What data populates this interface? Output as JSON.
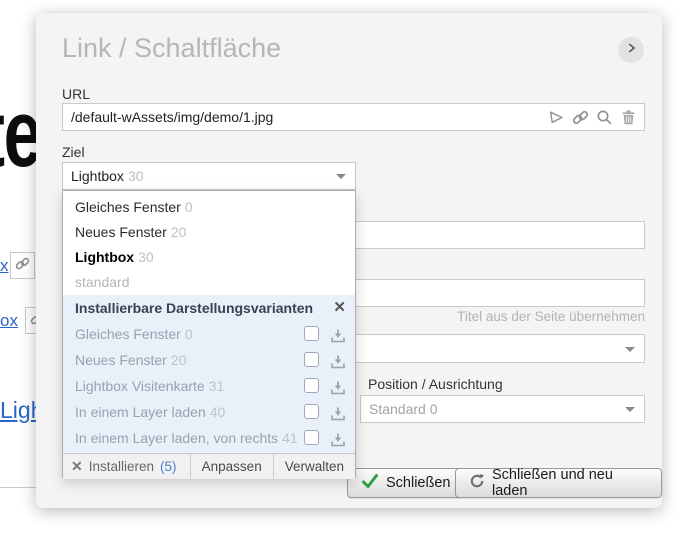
{
  "background": {
    "heading_fragment": "te",
    "link1": "x",
    "link2": "ox",
    "link3": "Ligh"
  },
  "dialog": {
    "title": "Link / Schaltfläche",
    "url": {
      "label": "URL",
      "value": "/default-wAssets/img/demo/1.jpg"
    },
    "ziel": {
      "label": "Ziel",
      "selected": "Lightbox",
      "selected_num": "30"
    },
    "dropdown": {
      "items": [
        {
          "label": "Gleiches Fenster",
          "num": "0"
        },
        {
          "label": "Neues Fenster",
          "num": "20"
        },
        {
          "label": "Lightbox",
          "num": "30"
        },
        {
          "label": "standard",
          "num": ""
        }
      ],
      "installable": {
        "header": "Installierbare Darstellungsvarianten",
        "close": "✕",
        "rows": [
          {
            "label": "Gleiches Fenster",
            "num": "0"
          },
          {
            "label": "Neues Fenster",
            "num": "20"
          },
          {
            "label": "Lightbox Visitenkarte",
            "num": "31"
          },
          {
            "label": "In einem Layer laden",
            "num": "40"
          },
          {
            "label": "In einem Layer laden, von rechts",
            "num": "41"
          }
        ]
      },
      "footer": {
        "close_glyph": "✕",
        "install_label": "Installieren",
        "install_count": "(5)",
        "anpassen": "Anpassen",
        "verwalten": "Verwalten"
      }
    },
    "right": {
      "title_hint": "Titel aus der Seite übernehmen",
      "position_label": "Position / Ausrichtung",
      "position_value": "Standard 0"
    },
    "buttons": {
      "close": "Schließen",
      "close_reload": "Schließen und neu laden"
    }
  },
  "colors": {
    "dialog_bg": "#f4f4f4",
    "panel_blue": "#e9f0f9",
    "link_blue": "#2a66c8",
    "count_blue": "#4d7fd0",
    "check_green": "#2f9e44",
    "title_gray": "#b6b6b6"
  }
}
